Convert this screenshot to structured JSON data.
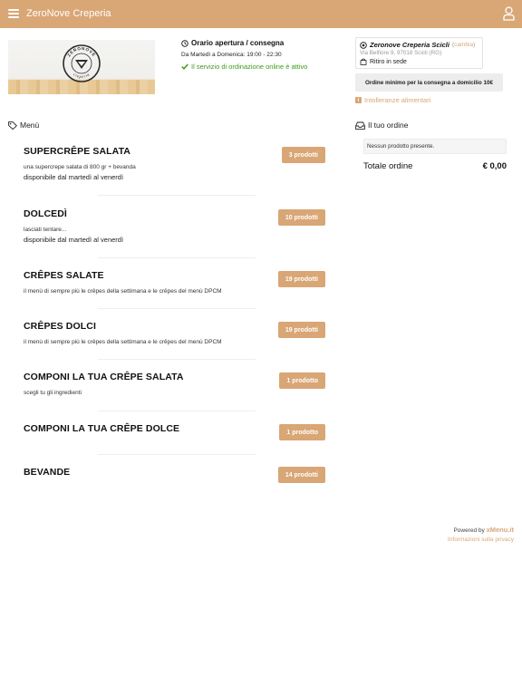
{
  "app": {
    "title": "ZeroNove Creperia"
  },
  "hours": {
    "title": "Orario apertura / consegna",
    "schedule": "Da Martedì a Domenica: 19:00 - 22:30",
    "online_status": "Il servizio di ordinazione online è attivo"
  },
  "store": {
    "name": "Zeronove Creperia Scicli",
    "change_label": "cambia",
    "address": "Via Belfiore 9, 97018 Scicli (RG)",
    "mode": "Ritiro in sede",
    "min_order": "Ordine minimo per la consegna a domicilio 10€",
    "intolerances": "Intolleranze alimentari"
  },
  "logo": {
    "top_text": "ZERONOVE",
    "bottom_text": "creperia"
  },
  "menu": {
    "title": "Menù",
    "categories": [
      {
        "name": "SUPERCRÊPE SALATA",
        "description": "una supercrepe salata di 800 gr + bevanda",
        "availability": "disponibile dal martedì al venerdì",
        "count": "3 prodotti"
      },
      {
        "name": "DOLCEDÌ",
        "description": "lasciati tentare...",
        "availability": "disponibile dal martedì al venerdì",
        "count": "10 prodotti"
      },
      {
        "name": "CRÊPES SALATE",
        "description": "il menù di sempre più le crêpes della settimana e le crêpes del menù DPCM",
        "availability": "",
        "count": "19 prodotti"
      },
      {
        "name": "CRÊPES DOLCI",
        "description": "il menù di sempre più le crêpes della settimana e le crêpes del menù DPCM",
        "availability": "",
        "count": "19 prodotti"
      },
      {
        "name": "COMPONI LA TUA CRÊPE SALATA",
        "description": "scegli tu gli ingredienti",
        "availability": "",
        "count": "1 prodotto"
      },
      {
        "name": "COMPONI LA TUA CRÊPE DOLCE",
        "description": "",
        "availability": "",
        "count": "1 prodotto"
      },
      {
        "name": "BEVANDE",
        "description": "",
        "availability": "",
        "count": "14 prodotti"
      }
    ]
  },
  "order": {
    "title": "Il tuo ordine",
    "empty_text": "Nessun prodotto presente.",
    "total_label": "Totale ordine",
    "total_value": "€ 0,00"
  },
  "footer": {
    "powered_by": "Powered by",
    "brand": "xMenu.it",
    "privacy": "Informazioni sulla privacy"
  },
  "colors": {
    "accent": "#d9a675",
    "success": "#3c9a1a"
  }
}
